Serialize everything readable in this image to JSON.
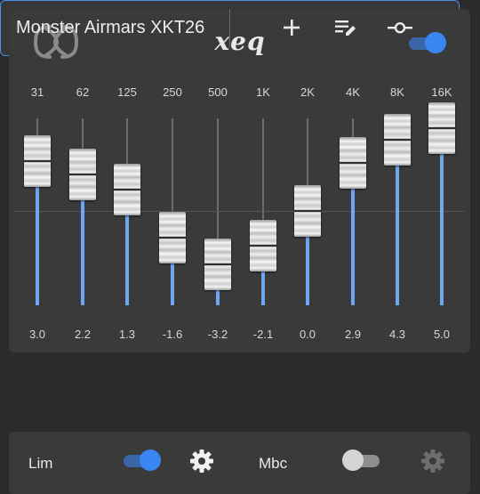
{
  "header": {
    "app_title": "xeq",
    "logo_icon": "xeq-logo-icon",
    "master_toggle": {
      "state": "on"
    }
  },
  "eq": {
    "bands": [
      {
        "freq": "31",
        "gain": "3.0",
        "value": 3.0
      },
      {
        "freq": "62",
        "gain": "2.2",
        "value": 2.2
      },
      {
        "freq": "125",
        "gain": "1.3",
        "value": 1.3
      },
      {
        "freq": "250",
        "gain": "-1.6",
        "value": -1.6
      },
      {
        "freq": "500",
        "gain": "-3.2",
        "value": -3.2
      },
      {
        "freq": "1K",
        "gain": "-2.1",
        "value": -2.1
      },
      {
        "freq": "2K",
        "gain": "0.0",
        "value": 0.0
      },
      {
        "freq": "4K",
        "gain": "2.9",
        "value": 2.9
      },
      {
        "freq": "8K",
        "gain": "4.3",
        "value": 4.3
      },
      {
        "freq": "16K",
        "gain": "5.0",
        "value": 5.0
      }
    ],
    "fill_color": "#6fa6f2"
  },
  "preset": {
    "name": "Monster Airmars XKT26",
    "actions": [
      "add-icon",
      "edit-list-icon",
      "slider-point-icon"
    ],
    "border_color": "#4a8ee8"
  },
  "effects": {
    "limiter": {
      "label": "Lim",
      "toggle": "on",
      "settings_icon": "gear-icon"
    },
    "mbc": {
      "label": "Mbc",
      "toggle": "off",
      "settings_icon": "gear-icon"
    }
  }
}
